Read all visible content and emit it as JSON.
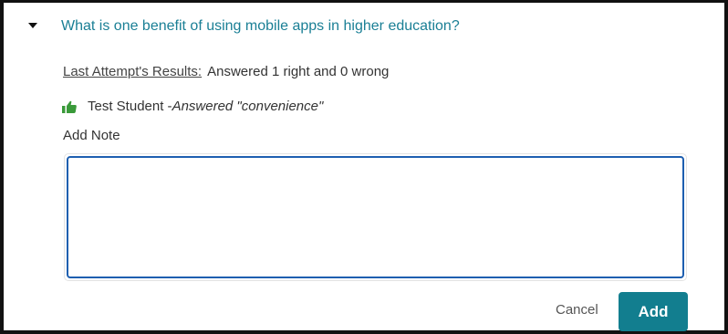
{
  "question": {
    "title": "What is one benefit of using mobile apps in higher education?",
    "toggle_icon": "caret-down-icon"
  },
  "results": {
    "label": "Last Attempt's Results:",
    "summary": "Answered 1 right and 0 wrong"
  },
  "student_answer": {
    "icon": "thumbs-up-icon",
    "icon_color": "#3a9a3a",
    "name": "Test Student - ",
    "answer": "Answered \"convenience\""
  },
  "note": {
    "label": "Add Note",
    "value": ""
  },
  "actions": {
    "cancel_label": "Cancel",
    "add_label": "Add",
    "add_color": "#127e8f"
  }
}
